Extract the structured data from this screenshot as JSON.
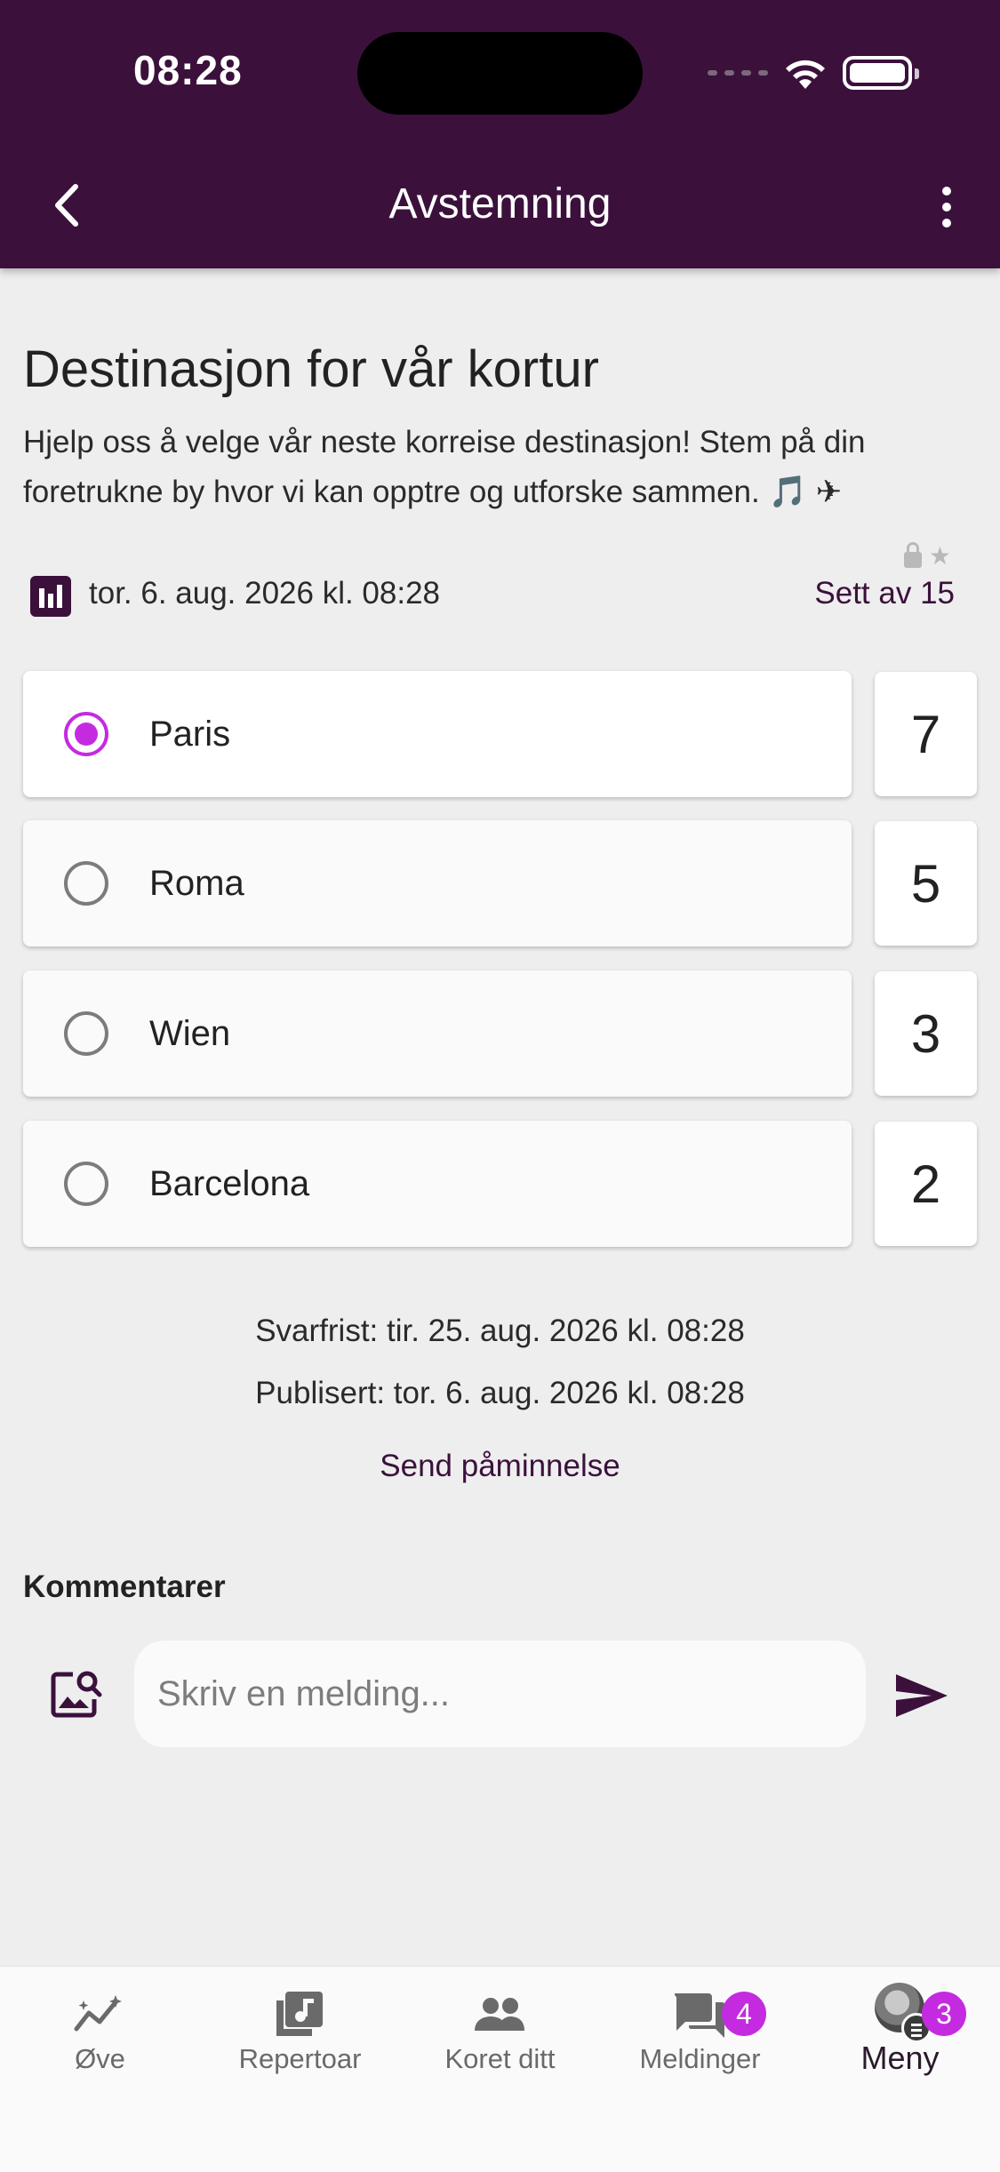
{
  "status_bar": {
    "time": "08:28"
  },
  "appbar": {
    "title": "Avstemning"
  },
  "poll": {
    "title": "Destinasjon for vår kortur",
    "description": "Hjelp oss å velge vår neste korreise destinasjon! Stem på din foretrukne by hvor vi kan opptre og utforske sammen. 🎵 ✈",
    "date": "tor. 6. aug. 2026 kl. 08:28",
    "seen_by": "Sett av 15",
    "options": [
      {
        "label": "Paris",
        "count": "7",
        "selected": true
      },
      {
        "label": "Roma",
        "count": "5",
        "selected": false
      },
      {
        "label": "Wien",
        "count": "3",
        "selected": false
      },
      {
        "label": "Barcelona",
        "count": "2",
        "selected": false
      }
    ],
    "deadline": "Svarfrist: tir. 25. aug. 2026 kl. 08:28",
    "published": "Publisert: tor. 6. aug. 2026 kl. 08:28",
    "remind_label": "Send påminnelse"
  },
  "comments": {
    "heading": "Kommentarer",
    "input_placeholder": "Skriv en melding..."
  },
  "bottom_nav": {
    "items": [
      {
        "label": "Øve",
        "icon": "trend-icon"
      },
      {
        "label": "Repertoar",
        "icon": "music-library-icon"
      },
      {
        "label": "Koret ditt",
        "icon": "group-icon"
      },
      {
        "label": "Meldinger",
        "icon": "chat-icon",
        "badge": "4"
      },
      {
        "label": "Meny",
        "icon": "avatar",
        "badge": "3",
        "active": true
      }
    ]
  },
  "colors": {
    "primary": "#3b113c",
    "accent": "#c42be0",
    "background": "#eeeeee"
  }
}
